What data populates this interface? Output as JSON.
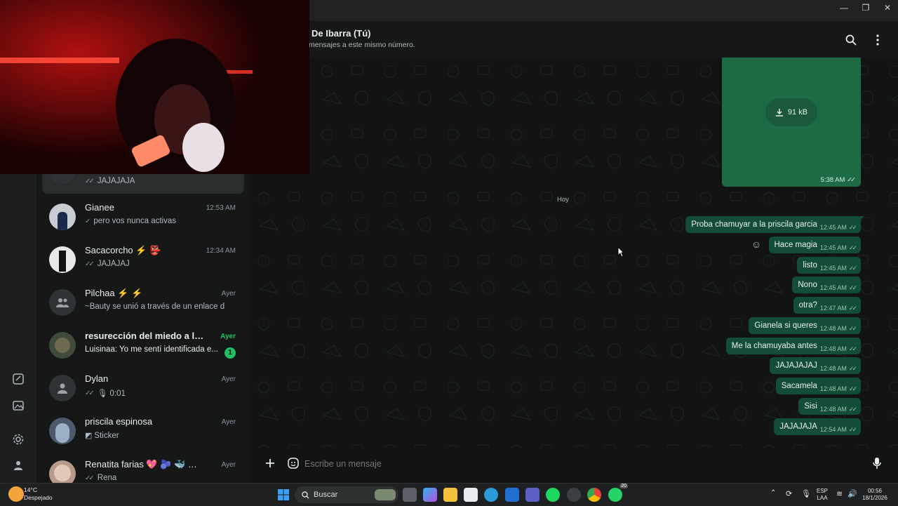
{
  "window": {
    "minimize": "—",
    "restore": "❐",
    "close": "✕"
  },
  "header": {
    "title": "De Ibarra (Tú)",
    "subtitle": "mensajes a este mismo número."
  },
  "rail": {
    "icons": [
      "status-icon",
      "media-icon",
      "settings-icon",
      "profile-icon"
    ]
  },
  "chats": [
    {
      "name": "",
      "time": "",
      "preview": "JAJAJAJA",
      "ticks": true,
      "selected": true
    },
    {
      "name": "Gianee",
      "time": "12:53 AM",
      "preview": "pero vos nunca activas",
      "ticks": "single"
    },
    {
      "name": "Sacacorcho ⚡ 👺",
      "time": "12:34 AM",
      "preview": "JAJAJAJ",
      "ticks": true
    },
    {
      "name": "Pilchaa ⚡ ⚡",
      "time": "Ayer",
      "preview": "~Bauty se unió a través de un enlace d...",
      "ticks": false,
      "group": true
    },
    {
      "name": "resurección del miedo a las p...",
      "time": "Ayer",
      "preview": "Luisinaa: Yo me sentí identificada e...",
      "ticks": false,
      "unread": "1"
    },
    {
      "name": "Dylan",
      "time": "Ayer",
      "preview": "🎙 0:01",
      "ticks": true,
      "generic": true
    },
    {
      "name": "priscila espinosa",
      "time": "Ayer",
      "preview": "Sticker",
      "ticks": false,
      "sticker": true
    },
    {
      "name": "Renatita farias 💖 🫐 🐳 🦄...",
      "time": "Ayer",
      "preview": "Rena",
      "ticks": true
    }
  ],
  "media": {
    "size": "91 kB",
    "time": "5:38 AM"
  },
  "day_divider": "Hoy",
  "messages": [
    {
      "text": "Proba chamuyar a la priscila garcia",
      "time": "12:45 AM"
    },
    {
      "text": "Hace magia",
      "time": "12:45 AM"
    },
    {
      "text": "listo",
      "time": "12:45 AM"
    },
    {
      "text": "Nono",
      "time": "12:45 AM"
    },
    {
      "text": "otra?",
      "time": "12:47 AM"
    },
    {
      "text": "Gianela si queres",
      "time": "12:48 AM"
    },
    {
      "text": "Me la chamuyaba antes",
      "time": "12:48 AM"
    },
    {
      "text": "JAJAJAJAJ",
      "time": "12:48 AM"
    },
    {
      "text": "Sacamela",
      "time": "12:48 AM"
    },
    {
      "text": "Sisi",
      "time": "12:48 AM"
    },
    {
      "text": "JAJAJAJA",
      "time": "12:54 AM"
    }
  ],
  "composer": {
    "placeholder": "Escribe un mensaje"
  },
  "taskbar": {
    "weather_temp": "14°C",
    "weather_desc": "Despejado",
    "search": "Buscar",
    "lang_top": "ESP",
    "lang_bottom": "LAA",
    "clock_time": "00:56",
    "clock_date": "18/1/2026",
    "whatsapp_badge": "20"
  },
  "colors": {
    "accent": "#21c063",
    "bubble_out": "#144d37",
    "panel": "#161717"
  }
}
